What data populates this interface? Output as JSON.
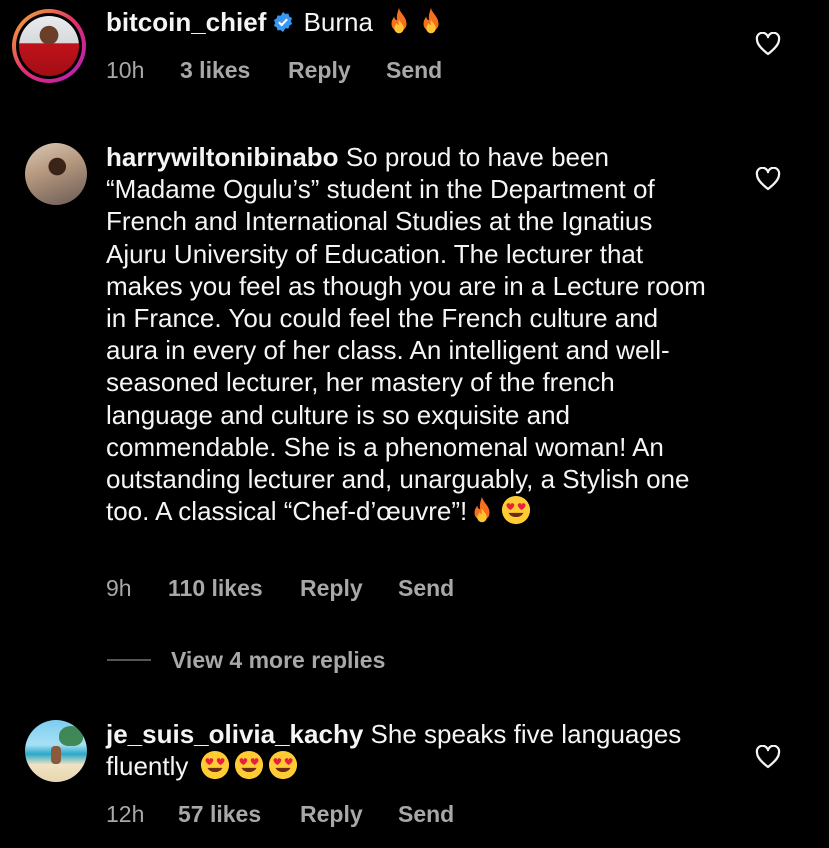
{
  "comments": [
    {
      "username": "bitcoin_chief",
      "verified": true,
      "text": "Burna",
      "emojis": [
        "fire",
        "fire"
      ],
      "time": "10h",
      "likes": "3 likes",
      "reply": "Reply",
      "send": "Send"
    },
    {
      "username": "harrywiltonibinabo",
      "verified": false,
      "text": "So proud to have been “Madame Ogulu’s” student in the Department of French and International Studies at the Ignatius Ajuru University of Education. The lecturer that makes you feel as though you are in a Lecture room in France. You could feel the French culture and aura in every of her class. An intelligent and well-seasoned lecturer, her mastery of the french language and culture is so exquisite and commendable. She is a phenomenal woman! An outstanding lecturer and, unarguably, a Stylish one too. A classical “Chef-d’œuvre”!",
      "emojis": [
        "fire",
        "heart-eyes"
      ],
      "time": "9h",
      "likes": "110 likes",
      "reply": "Reply",
      "send": "Send"
    },
    {
      "username": "je_suis_olivia_kachy",
      "verified": false,
      "text": "She speaks five languages fluently",
      "emojis": [
        "heart-eyes",
        "heart-eyes",
        "heart-eyes"
      ],
      "time": "12h",
      "likes": "57 likes",
      "reply": "Reply",
      "send": "Send"
    }
  ],
  "view_more": "View 4 more replies",
  "colors": {
    "background": "#000000",
    "text": "#f5f5f5",
    "meta": "#a8a8a8",
    "verified": "#3897f0"
  }
}
